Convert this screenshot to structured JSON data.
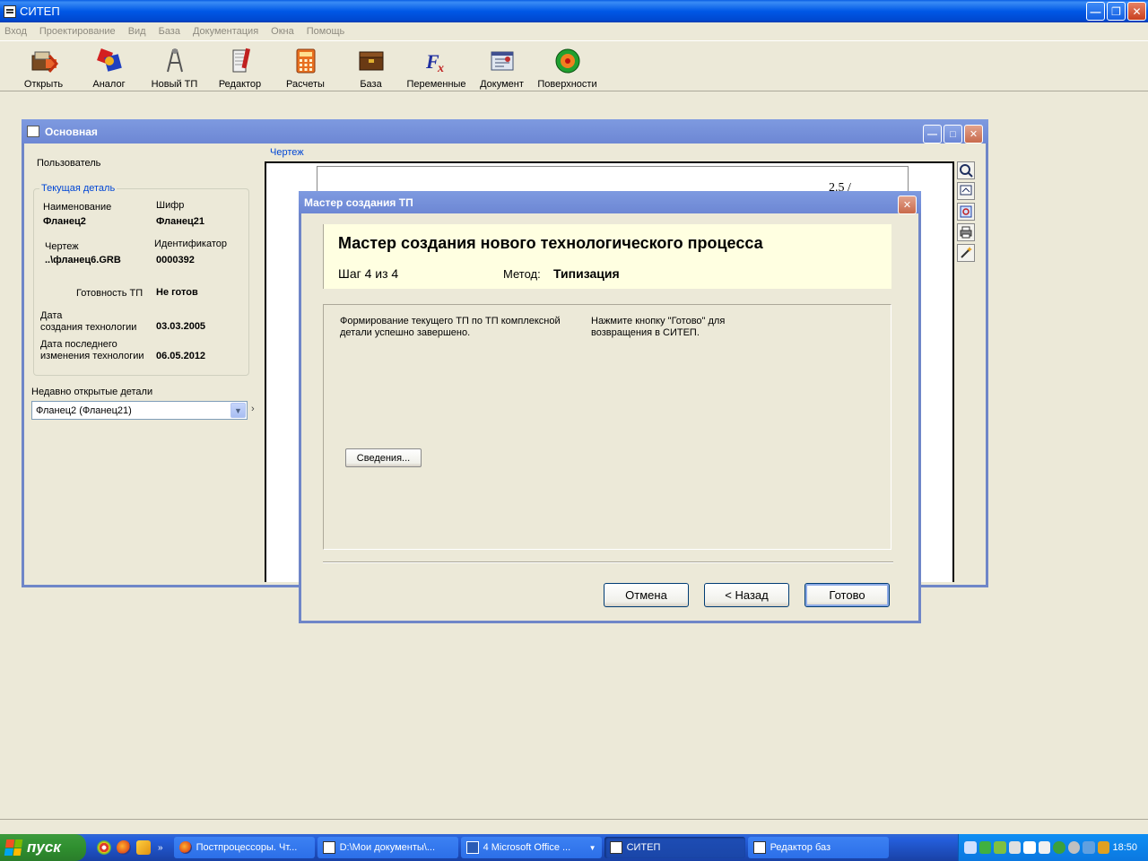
{
  "app": {
    "title": "СИТЕП",
    "menu": [
      "Вход",
      "Проектирование",
      "Вид",
      "База",
      "Документация",
      "Окна",
      "Помощь"
    ],
    "toolbar": [
      {
        "label": "Открыть",
        "icon": "open-icon"
      },
      {
        "label": "Аналог",
        "icon": "analog-icon"
      },
      {
        "label": "Новый ТП",
        "icon": "new-tp-icon"
      },
      {
        "label": "Редактор",
        "icon": "editor-icon"
      },
      {
        "label": "Расчеты",
        "icon": "calculator-icon"
      },
      {
        "label": "База",
        "icon": "database-icon"
      },
      {
        "label": "Переменные",
        "icon": "fx-icon"
      },
      {
        "label": "Документ",
        "icon": "document-icon"
      },
      {
        "label": "Поверхности",
        "icon": "surfaces-icon"
      }
    ]
  },
  "main_window": {
    "title": "Основная",
    "user_label": "Пользователь",
    "group_title": "Текущая деталь",
    "name_label": "Наименование",
    "name_value": "Фланец2",
    "code_label": "Шифр",
    "code_value": "Фланец21",
    "drawing_label": "Чертеж",
    "drawing_value": "..\\фланец6.GRB",
    "id_label": "Идентификатор",
    "id_value": "0000392",
    "ready_label": "Готовность ТП",
    "ready_value": "Не готов",
    "created_label_1": "Дата",
    "created_label_2": "создания технологии",
    "created_value": "03.03.2005",
    "modified_label_1": "Дата последнего",
    "modified_label_2": "изменения технологии",
    "modified_value": "06.05.2012",
    "recent_label": "Недавно открытые детали",
    "recent_value": "Фланец2 (Фланец21)",
    "drawing_panel_label": "Чертеж",
    "drawing_fragment": "2.5 /"
  },
  "wizard": {
    "title": "Мастер создания ТП",
    "heading": "Мастер создания нового технологического процесса",
    "step": "Шаг 4 из 4",
    "method_label": "Метод:",
    "method_value": "Типизация",
    "text_left": "Формирование текущего ТП по ТП комплексной детали успешно завершено.",
    "text_right": "Нажмите кнопку \"Готово\" для возвращения в СИТЕП.",
    "details_button": "Сведения...",
    "cancel_button": "Отмена",
    "back_button": "< Назад",
    "finish_button": "Готово"
  },
  "taskbar": {
    "start_label": "пуск",
    "tasks": [
      {
        "label": "Постпроцессоры. Чт..."
      },
      {
        "label": "D:\\Мои документы\\..."
      },
      {
        "label": "4 Microsoft Office ..."
      },
      {
        "label": "СИТЕП"
      },
      {
        "label": "Редактор баз"
      }
    ],
    "clock": "18:50"
  },
  "colors": {
    "title_active": "#0058e6",
    "title_inactive": "#7e9ae0",
    "wizard_header_bg": "#ffffe1",
    "group_legend": "#0046d5"
  }
}
